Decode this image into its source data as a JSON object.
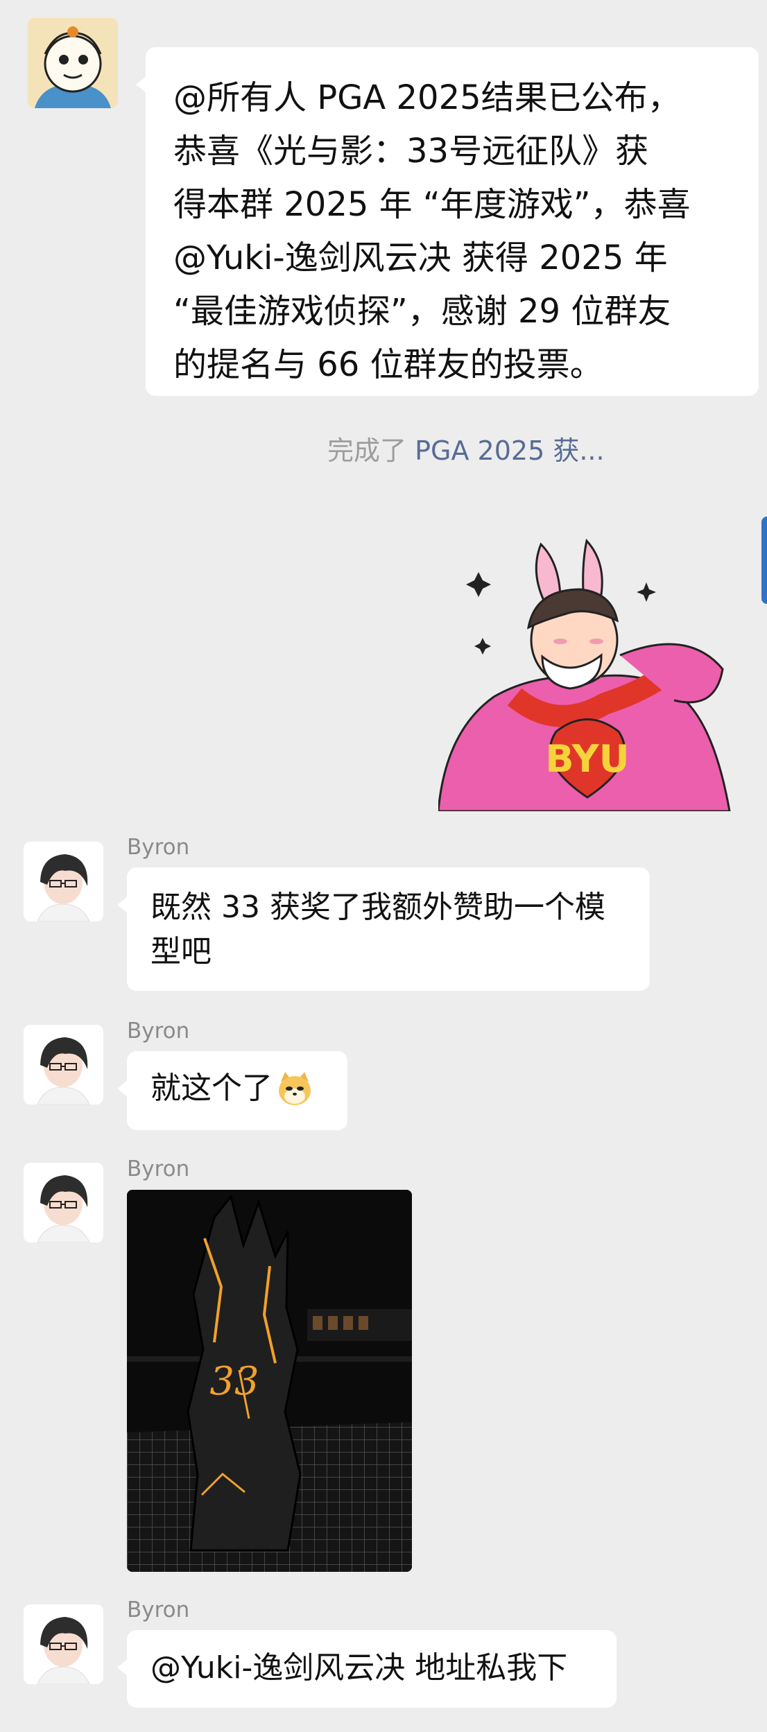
{
  "colors": {
    "background": "#ededed",
    "bubble": "#ffffff",
    "sender_name": "#8a8a8a",
    "system_text": "#9d9d9d",
    "link": "#576b95"
  },
  "messages": [
    {
      "type": "text",
      "avatar_icon": "cartoon-avatar-icon",
      "text": "@所有人 PGA 2025结果已公布，\n恭喜《光与影：33号远征队》获\n得本群 2025 年 “年度游戏”，恭喜\n@Yuki-逸剑风云决 获得 2025 年\n“最佳游戏侦探”，感谢 29 位群友\n的提名与 66 位群友的投票。"
    },
    {
      "type": "system",
      "prefix": "完成了",
      "link": "PGA 2025 获..."
    },
    {
      "type": "sticker",
      "sticker_icon": "pink-rabbit-sticker-icon",
      "sticker_text": "BYU"
    },
    {
      "type": "text",
      "sender": "Byron",
      "avatar_icon": "anime-avatar-icon",
      "text": "既然 33 获奖了我额外赞助一个模\n型吧"
    },
    {
      "type": "text",
      "sender": "Byron",
      "avatar_icon": "anime-avatar-icon",
      "text": "就这个了",
      "emoji_icon": "doge-emoji-icon"
    },
    {
      "type": "image",
      "sender": "Byron",
      "avatar_icon": "anime-avatar-icon",
      "image_icon": "dark-model-photo-icon",
      "image_text": "33"
    },
    {
      "type": "text",
      "sender": "Byron",
      "avatar_icon": "anime-avatar-icon",
      "text": "@Yuki-逸剑风云决 地址私我下"
    }
  ]
}
